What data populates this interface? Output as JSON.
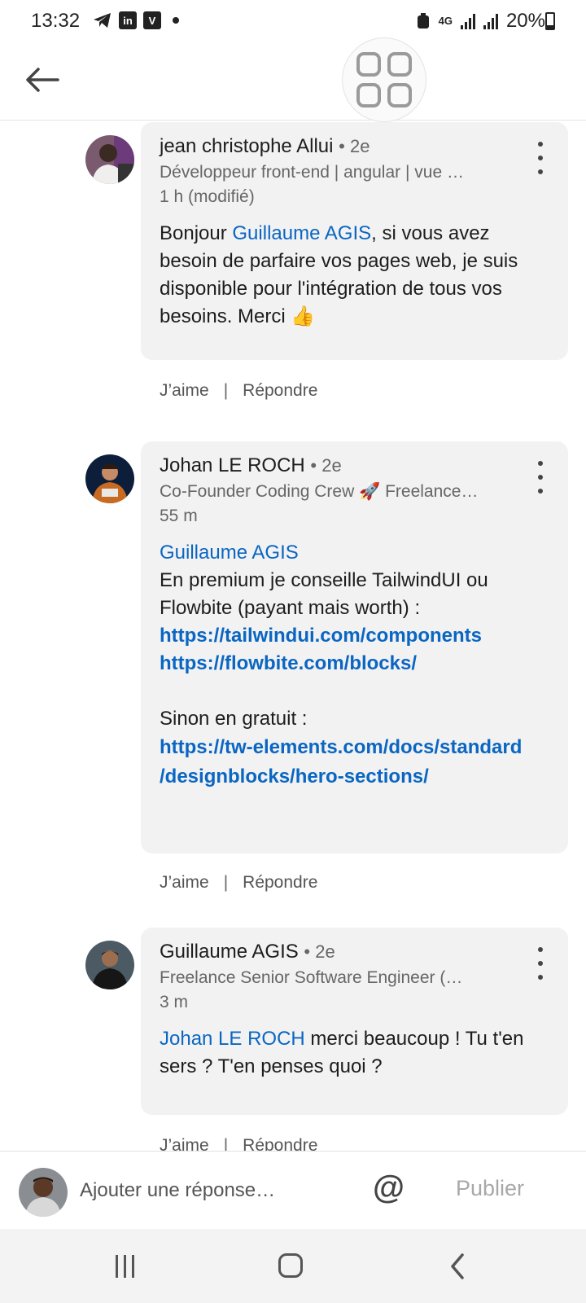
{
  "status_bar": {
    "time": "13:32",
    "icons_left": [
      "telegram-icon",
      "linkedin-icon",
      "vimeo-icon"
    ],
    "net_label": "4G",
    "battery": "20%"
  },
  "top_bar": {
    "back_icon": "arrow-left-icon",
    "apps_icon": "apps-grid-icon"
  },
  "comments": [
    {
      "author": "jean christophe Allui",
      "degree": "• 2e",
      "headline": "Développeur front-end | angular | vue …",
      "time": "1 h (modifié)",
      "mention": "Guillaume AGIS",
      "text_before": "Bonjour ",
      "text_after": ", si vous avez besoin de parfaire vos pages web, je suis disponible pour l'intégration de tous vos besoins. Merci ",
      "emoji": "👍",
      "like_label": "J’aime",
      "reply_label": "Répondre"
    },
    {
      "author": "Johan LE ROCH",
      "degree": "• 2e",
      "headline": "Co-Founder Coding Crew 🚀 Freelance…",
      "time": "55 m",
      "mention": "Guillaume AGIS",
      "line1": "En premium je conseille TailwindUI ou Flowbite (payant mais worth) :",
      "link1": "https://tailwindui.com/components",
      "link2": "https://flowbite.com/blocks/",
      "line2": "Sinon en gratuit :",
      "link3a": "https://tw-elements.com/docs/standard",
      "link3b": "/designblocks/hero-sections/",
      "like_label": "J’aime",
      "reply_label": "Répondre"
    },
    {
      "author": "Guillaume AGIS",
      "degree": "• 2e",
      "headline": "Freelance Senior Software Engineer (…",
      "time": "3 m",
      "mention": "Johan LE ROCH",
      "text_after": " merci beaucoup ! Tu t'en sers ? T'en penses quoi ?",
      "like_label": "J’aime",
      "reply_label": "Répondre"
    }
  ],
  "reply_bar": {
    "placeholder": "Ajouter une réponse…",
    "at_symbol": "@",
    "publish_label": "Publier"
  },
  "nav_bar": {
    "icons": [
      "recent-apps-icon",
      "home-icon",
      "back-icon"
    ]
  },
  "colors": {
    "accent": "#0a66c2",
    "bubble": "#f2f2f2",
    "muted": "#666666"
  }
}
